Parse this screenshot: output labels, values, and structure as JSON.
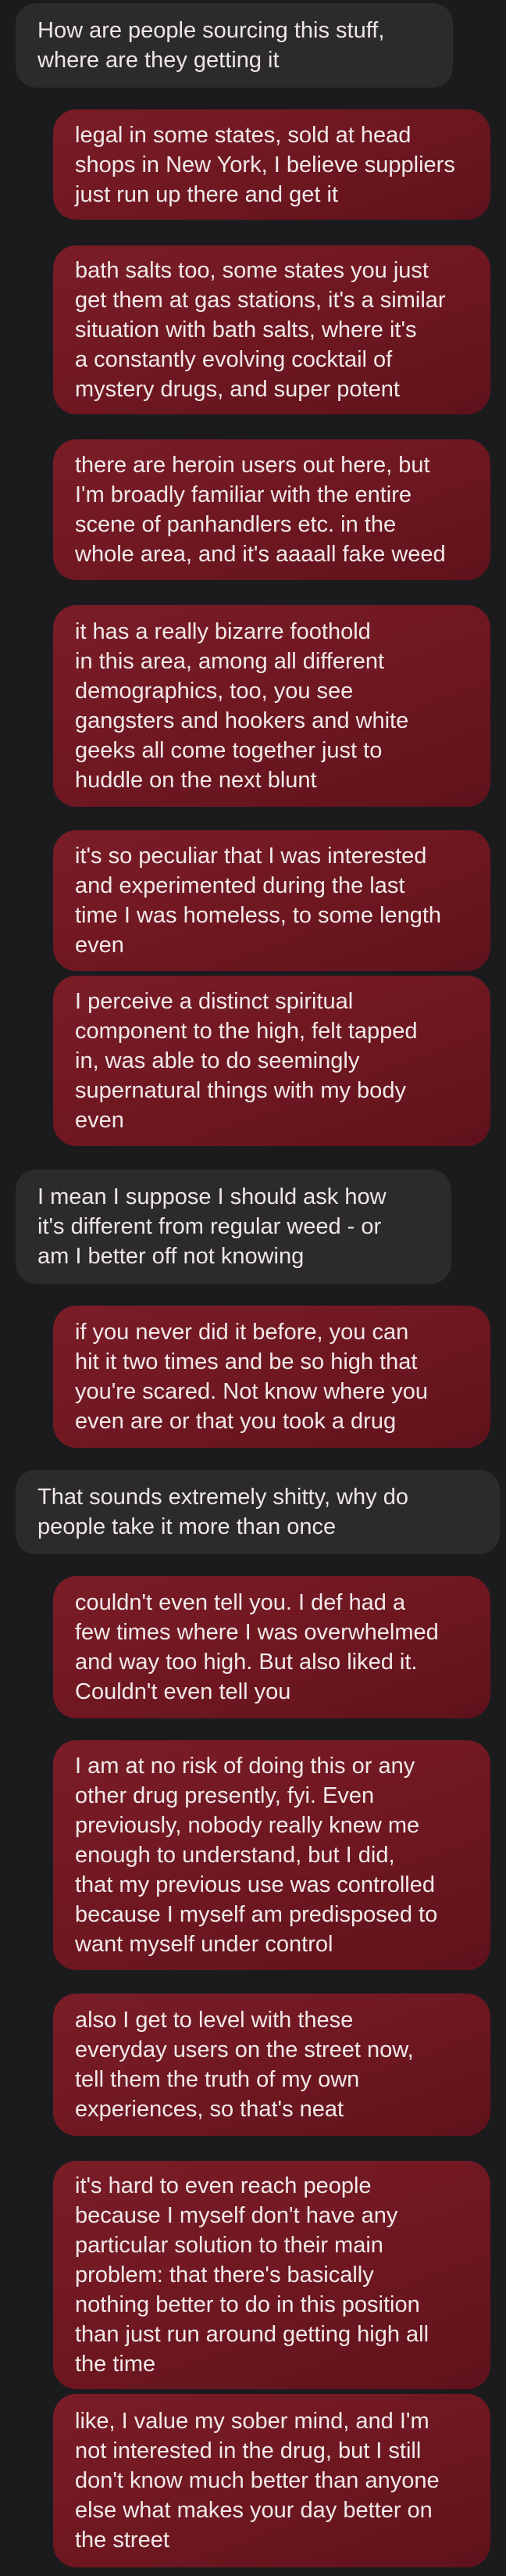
{
  "messages": [
    {
      "direction": "received",
      "lines": [
        "How are people sourcing this stuff,",
        "where are they getting it"
      ]
    },
    {
      "direction": "sent",
      "lines": [
        "legal in some states, sold at head",
        "shops in New York, I believe suppliers",
        "just run up there and get it"
      ]
    },
    {
      "direction": "sent",
      "lines": [
        "bath salts too, some states you just",
        "get them at gas stations, it's a similar",
        "situation with bath salts, where it's",
        "a constantly evolving cocktail of",
        "mystery drugs, and super potent"
      ]
    },
    {
      "direction": "sent",
      "lines": [
        "there are heroin users out here, but",
        "I'm broadly familiar with the entire",
        "scene of panhandlers etc. in the",
        "whole area, and it's aaaall fake weed"
      ]
    },
    {
      "direction": "sent",
      "lines": [
        "it has a really bizarre foothold",
        "in this area, among all different",
        "demographics, too, you see",
        "gangsters and hookers and white",
        "geeks all come together just to",
        "huddle on the next blunt"
      ]
    },
    {
      "direction": "sent",
      "lines": [
        "it's so peculiar that I was interested",
        "and experimented during the last",
        "time I was homeless, to some length",
        "even"
      ]
    },
    {
      "direction": "sent",
      "lines": [
        "I perceive a distinct spiritual",
        "component to the high, felt tapped",
        "in, was able to do seemingly",
        "supernatural things with my body",
        "even"
      ]
    },
    {
      "direction": "received",
      "lines": [
        "I mean I suppose I should ask how",
        "it's different from regular weed - or",
        "am I better off not knowing"
      ]
    },
    {
      "direction": "sent",
      "lines": [
        "if you never did it before, you can",
        "hit it two times and be so high that",
        "you're scared. Not know where you",
        "even are or that you took a drug"
      ]
    },
    {
      "direction": "received",
      "lines": [
        "That sounds extremely shitty, why do",
        "people take it more than once"
      ]
    },
    {
      "direction": "sent",
      "lines": [
        "couldn't even tell you. I def had a",
        "few times where I was overwhelmed",
        "and way too high. But also liked it.",
        "Couldn't even tell you"
      ]
    },
    {
      "direction": "sent",
      "lines": [
        "I am at no risk of doing this or any",
        "other drug presently, fyi. Even",
        "previously, nobody really knew me",
        "enough to understand, but I did,",
        "that my previous use was controlled",
        "because I myself am predisposed to",
        "want myself under control"
      ]
    },
    {
      "direction": "sent",
      "lines": [
        "also I get to level with these",
        "everyday users on the street now,",
        "tell them the truth of my own",
        "experiences, so that's neat"
      ]
    },
    {
      "direction": "sent",
      "lines": [
        "it's hard to even reach people",
        "because I myself don't have any",
        "particular solution to their main",
        "problem: that there's basically",
        "nothing better to do in this position",
        "than just run around getting high all",
        "the time"
      ]
    },
    {
      "direction": "sent",
      "lines": [
        "like, I value my sober mind, and I'm",
        "not interested in the drug, but I still",
        "don't know much better than anyone",
        "else what makes your day better on",
        "the street"
      ]
    }
  ]
}
